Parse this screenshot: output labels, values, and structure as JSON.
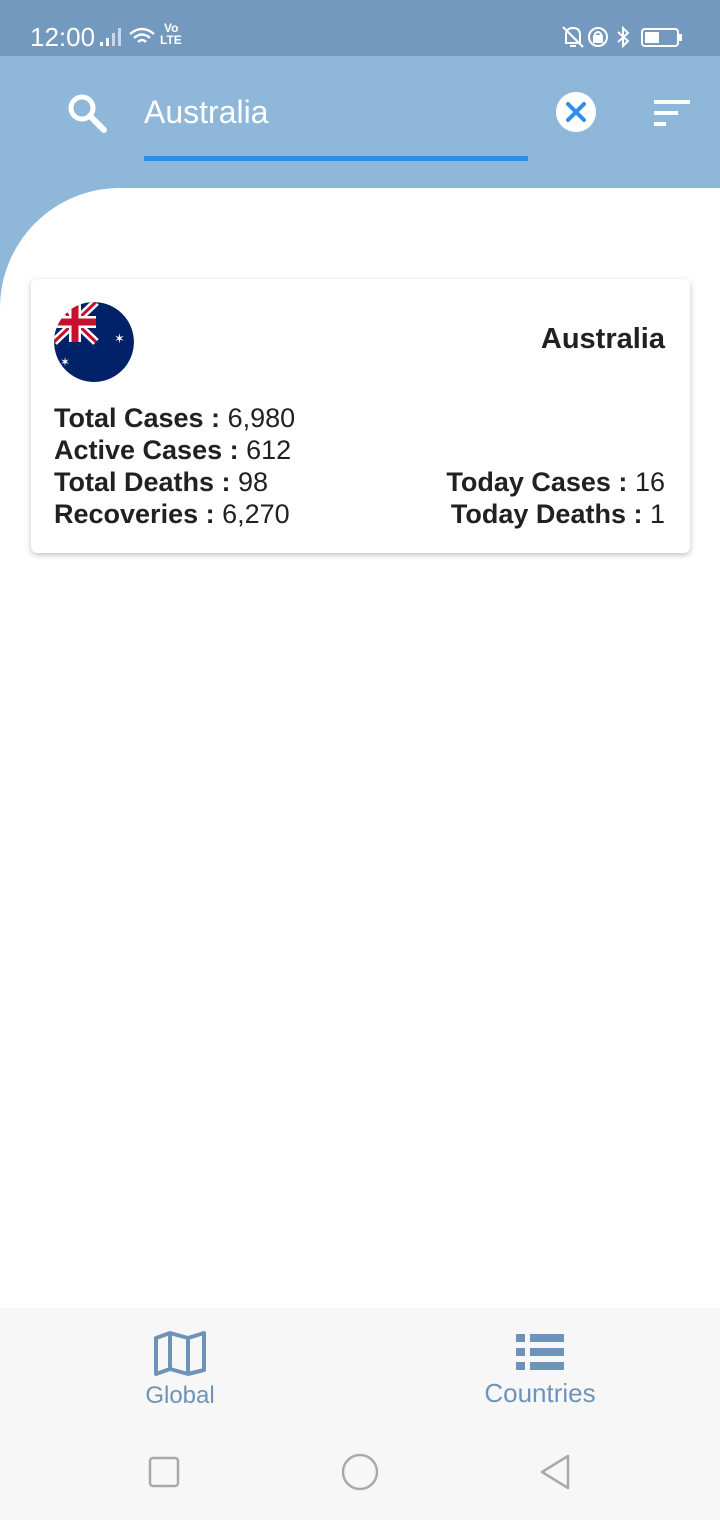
{
  "status_bar": {
    "time": "12:00",
    "volte_top": "Vo",
    "volte_bottom": "LTE",
    "icons_left": [
      "signal-icon",
      "wifi-icon"
    ],
    "icons_right": [
      "bell-off-icon",
      "rotation-lock-icon",
      "bluetooth-icon",
      "battery-icon"
    ],
    "battery_level": 0.4
  },
  "header": {
    "search_value": "Australia",
    "search_placeholder": "",
    "icons": [
      "search-icon",
      "clear-icon",
      "filter-icon"
    ],
    "background": "#8fb7d9",
    "underline_color": "#2f8ee5"
  },
  "card": {
    "country": "Australia",
    "flag_icon": "australia-flag-icon",
    "total_cases_label": "Total Cases :",
    "total_cases_value": "6,980",
    "active_cases_label": "Active Cases :",
    "active_cases_value": "612",
    "total_deaths_label": "Total Deaths :",
    "total_deaths_value": "98",
    "recoveries_label": "Recoveries :",
    "recoveries_value": "6,270",
    "today_cases_label": "Today Cases :",
    "today_cases_value": "16",
    "today_deaths_label": "Today Deaths :",
    "today_deaths_value": "1"
  },
  "bottom_nav": {
    "global_label": "Global",
    "countries_label": "Countries",
    "global_icon": "map-icon",
    "countries_icon": "list-icon",
    "color": "#6f93b8"
  },
  "system_nav": {
    "icons": [
      "recent-apps-icon",
      "home-icon",
      "back-icon"
    ]
  }
}
